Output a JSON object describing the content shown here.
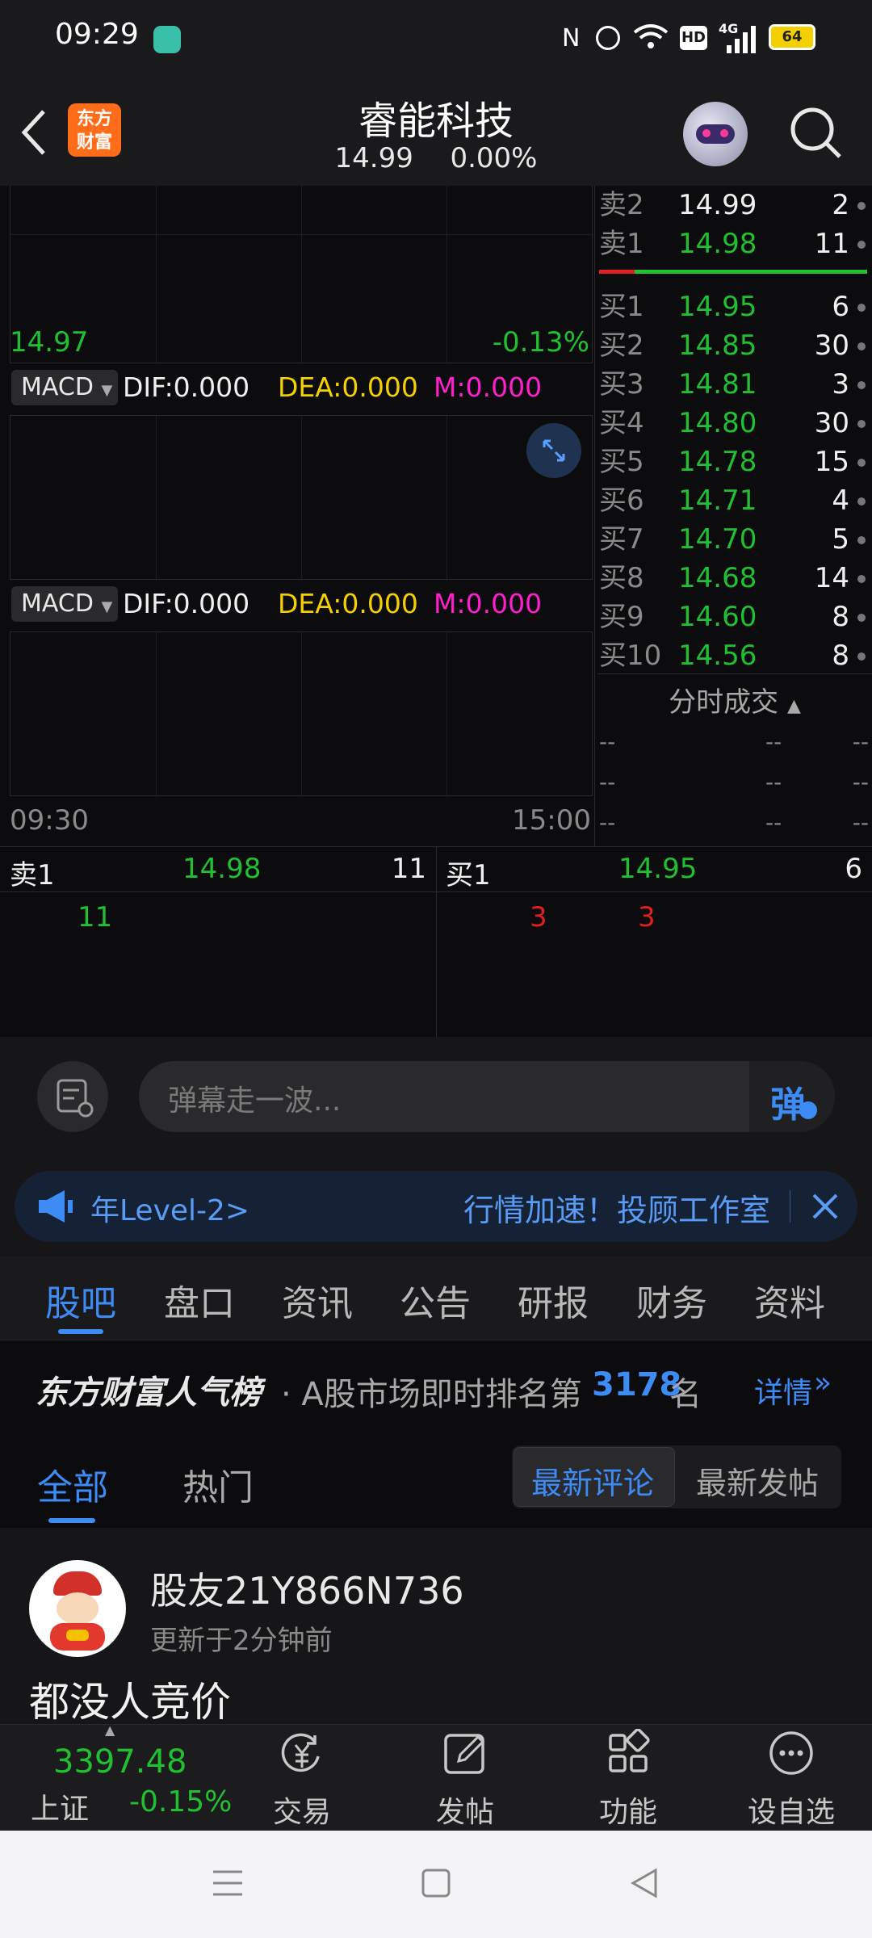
{
  "status_bar": {
    "time": "09:29",
    "battery": "64",
    "network": "4G",
    "hd": "HD"
  },
  "header": {
    "logo_text": "东方\n财富",
    "stock_name": "睿能科技",
    "price": "14.99",
    "change_pct": "0.00%"
  },
  "chart": {
    "left_price": "14.97",
    "right_pct": "-0.13%",
    "indicator1": {
      "name": "MACD",
      "dif": "DIF:0.000",
      "dea": "DEA:0.000",
      "m": "M:0.000"
    },
    "indicator2": {
      "name": "MACD",
      "dif": "DIF:0.000",
      "dea": "DEA:0.000",
      "m": "M:0.000"
    },
    "time_start": "09:30",
    "time_end": "15:00"
  },
  "order_book": {
    "asks": [
      {
        "label": "卖2",
        "price": "14.99",
        "volume": "2"
      },
      {
        "label": "卖1",
        "price": "14.98",
        "volume": "11"
      }
    ],
    "bids": [
      {
        "label": "买1",
        "price": "14.95",
        "volume": "6"
      },
      {
        "label": "买2",
        "price": "14.85",
        "volume": "30"
      },
      {
        "label": "买3",
        "price": "14.81",
        "volume": "3"
      },
      {
        "label": "买4",
        "price": "14.80",
        "volume": "30"
      },
      {
        "label": "买5",
        "price": "14.78",
        "volume": "15"
      },
      {
        "label": "买6",
        "price": "14.71",
        "volume": "4"
      },
      {
        "label": "买7",
        "price": "14.70",
        "volume": "5"
      },
      {
        "label": "买8",
        "price": "14.68",
        "volume": "14"
      },
      {
        "label": "买9",
        "price": "14.60",
        "volume": "8"
      },
      {
        "label": "买10",
        "price": "14.56",
        "volume": "8"
      }
    ],
    "ticks_title": "分时成交",
    "ticks": [
      {
        "time": "--",
        "price": "--",
        "vol": "--"
      },
      {
        "time": "--",
        "price": "--",
        "vol": "--"
      },
      {
        "time": "--",
        "price": "--",
        "vol": "--"
      }
    ]
  },
  "queue": {
    "sell": {
      "label": "卖1",
      "price": "14.98",
      "volume": "11",
      "orders": [
        "11"
      ]
    },
    "buy": {
      "label": "买1",
      "price": "14.95",
      "volume": "6",
      "orders": [
        "3",
        "3"
      ]
    }
  },
  "danmaku": {
    "placeholder": "弹幕走一波...",
    "button": "弹"
  },
  "banner": {
    "left_text": "年Level-2>",
    "right_text": "行情加速！投顾工作室"
  },
  "tabs": [
    "股吧",
    "盘口",
    "资讯",
    "公告",
    "研报",
    "财务",
    "资料"
  ],
  "active_tab": "股吧",
  "ranking": {
    "brand": "东方财富人气榜",
    "prefix": "· A股市场即时排名第",
    "rank": "3178",
    "suffix": "名",
    "detail": "详情"
  },
  "subtabs": {
    "all": "全部",
    "hot": "热门",
    "latest_comment": "最新评论",
    "latest_post": "最新发帖"
  },
  "post": {
    "user": "股友21Y866N736",
    "time": "更新于2分钟前",
    "content": "都没人竞价"
  },
  "bottom_nav": {
    "index_value": "3397.48",
    "index_name": "上证",
    "index_change": "-0.15%",
    "items": [
      "交易",
      "发帖",
      "功能",
      "设自选"
    ]
  },
  "colors": {
    "up": "#e02020",
    "down": "#20c030",
    "accent": "#3d8bf5",
    "background": "#0c0c0e"
  }
}
